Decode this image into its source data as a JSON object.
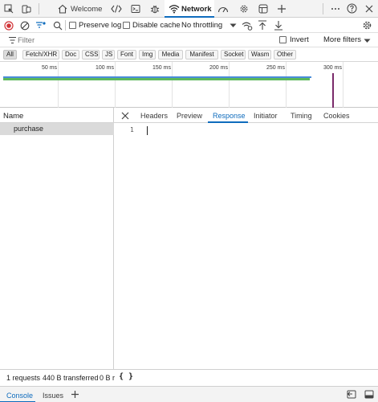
{
  "top_tabs": {
    "welcome_label": "Welcome",
    "network_label": "Network",
    "icons": [
      "device-icon",
      "inspect-icon",
      "welcome-home-icon",
      "elements-code-icon",
      "console-icon",
      "sources-bug-icon",
      "network-wifi-icon",
      "performance-icon",
      "memory-gear-icon",
      "application-icon",
      "add-tool-icon",
      "more-icon",
      "help-icon",
      "close-icon"
    ]
  },
  "toolbar": {
    "preserve_log_label": "Preserve log",
    "disable_cache_label": "Disable cache",
    "throttling_value": "No throttling"
  },
  "filter": {
    "placeholder": "Filter",
    "invert_label": "Invert",
    "more_filters_label": "More filters"
  },
  "type_filters": [
    "All",
    "Fetch/XHR",
    "Doc",
    "CSS",
    "JS",
    "Font",
    "Img",
    "Media",
    "Manifest",
    "Socket",
    "Wasm",
    "Other"
  ],
  "overview": {
    "ticks": [
      "50 ms",
      "100 ms",
      "150 ms",
      "200 ms",
      "250 ms",
      "300 ms"
    ]
  },
  "requests": {
    "column_name": "Name",
    "rows": [
      "purchase"
    ]
  },
  "detail": {
    "tabs": [
      "Headers",
      "Preview",
      "Response",
      "Initiator",
      "Timing",
      "Cookies"
    ],
    "active_tab": "Response",
    "line_number": "1"
  },
  "status": {
    "requests": "1 requests",
    "transferred": "440 B transferred",
    "resources": "0 B r",
    "braces": "{ }"
  },
  "drawer": {
    "console_label": "Console",
    "issues_label": "Issues"
  },
  "colors": {
    "accent": "#0f6cbd",
    "record": "#d13438",
    "timeline_green": "#5cb85c",
    "timeline_blue": "#4a8cd8",
    "load_marker": "#7a2a6a"
  }
}
